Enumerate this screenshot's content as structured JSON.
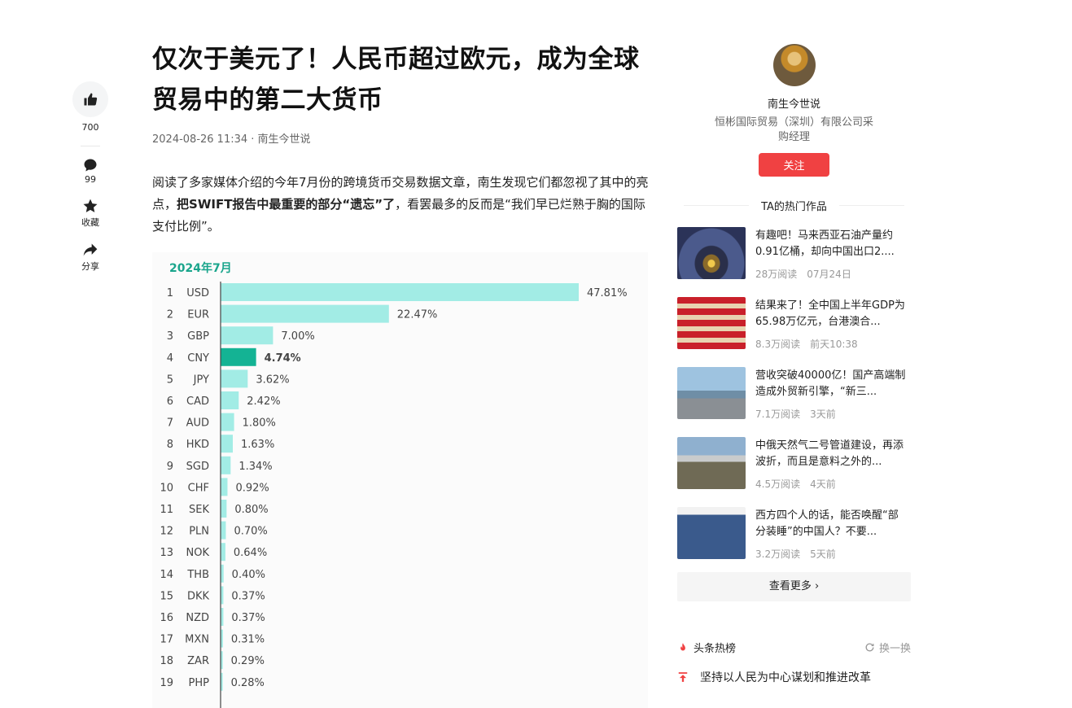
{
  "rail": {
    "like_count": "700",
    "comment_count": "99",
    "favorite_label": "收藏",
    "share_label": "分享"
  },
  "article": {
    "title": "仅次于美元了！人民币超过欧元，成为全球贸易中的第二大货币",
    "meta": "2024-08-26 11:34 · 南生今世说",
    "para_1": "阅读了多家媒体介绍的今年7月份的跨境货币交易数据文章，南生发现它们都忽视了其中的亮点，",
    "para_bold": "把SWIFT报告中最重要的部分“遗忘”了",
    "para_2": "，看罢最多的反而是“我们早已烂熟于胸的国际支付比例”。"
  },
  "chart_data": {
    "type": "bar",
    "orientation": "horizontal",
    "title": "2024年7月",
    "highlight": "CNY",
    "colors": {
      "bar": "#a2ece5",
      "highlight": "#14b394",
      "title": "#1aa58c"
    },
    "ranks": [
      1,
      2,
      3,
      4,
      5,
      6,
      7,
      8,
      9,
      10,
      11,
      12,
      13,
      14,
      15,
      16,
      17,
      18,
      19
    ],
    "categories": [
      "USD",
      "EUR",
      "GBP",
      "CNY",
      "JPY",
      "CAD",
      "AUD",
      "HKD",
      "SGD",
      "CHF",
      "SEK",
      "PLN",
      "NOK",
      "THB",
      "DKK",
      "NZD",
      "MXN",
      "ZAR",
      "PHP"
    ],
    "values": [
      47.81,
      22.47,
      7.0,
      4.74,
      3.62,
      2.42,
      1.8,
      1.63,
      1.34,
      0.92,
      0.8,
      0.7,
      0.64,
      0.4,
      0.37,
      0.37,
      0.31,
      0.29,
      0.28
    ],
    "labels": [
      "47.81%",
      "22.47%",
      "7.00%",
      "4.74%",
      "3.62%",
      "2.42%",
      "1.80%",
      "1.63%",
      "1.34%",
      "0.92%",
      "0.80%",
      "0.70%",
      "0.64%",
      "0.40%",
      "0.37%",
      "0.37%",
      "0.31%",
      "0.29%",
      "0.28%"
    ]
  },
  "sidebar": {
    "author_name": "南生今世说",
    "author_bio": "恒彬国际贸易（深圳）有限公司采购经理",
    "follow_label": "关注",
    "hot_heading": "TA的热门作品",
    "items": [
      {
        "title": "有趣吧！马来西亚石油产量约0.91亿桶，却向中国出口2....",
        "views": "28万阅读",
        "date": "07月24日"
      },
      {
        "title": "结果来了！全中国上半年GDP为65.98万亿元，台港澳合...",
        "views": "8.3万阅读",
        "date": "前天10:38"
      },
      {
        "title": "营收突破40000亿！国产高端制造成外贸新引擎，“新三...",
        "views": "7.1万阅读",
        "date": "3天前"
      },
      {
        "title": "中俄天然气二号管道建设，再添波折，而且是意料之外的...",
        "views": "4.5万阅读",
        "date": "4天前"
      },
      {
        "title": "西方四个人的话，能否唤醒“部分装睡”的中国人？不要...",
        "views": "3.2万阅读",
        "date": "5天前"
      }
    ],
    "more_label": "查看更多",
    "toplist_label": "头条热榜",
    "refresh_label": "换一换",
    "top_news_1": "坚持以人民为中心谋划和推进改革"
  }
}
